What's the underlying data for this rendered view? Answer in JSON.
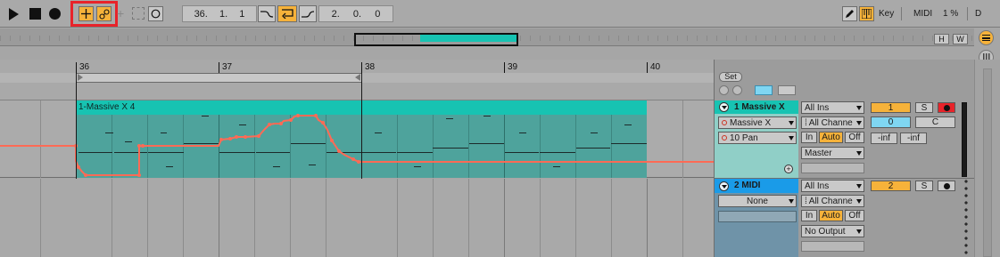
{
  "colors": {
    "accent_orange": "#f6b23a",
    "clip_teal": "#17c3b2",
    "clip_body": "#4ea39c",
    "automation": "#ff6a55",
    "track1_header": "#17c3b2",
    "track2_header": "#1a9be8",
    "highlight_red": "#e8232a"
  },
  "transport": {
    "play_icon": "play-icon",
    "stop_icon": "stop-icon",
    "record_icon": "record-icon",
    "add_icon": "plus-icon",
    "link_icon": "link-icon",
    "position": [
      "36.",
      "1.",
      "1"
    ],
    "loop_length": [
      "2.",
      "0.",
      "0"
    ]
  },
  "right_toolbar": {
    "key_label": "Key",
    "midi_label": "MIDI",
    "cpu_label": "1 %",
    "d_label": "D"
  },
  "overview": {
    "h_label": "H",
    "w_label": "W"
  },
  "ruler": {
    "bars": [
      "36",
      "37",
      "38",
      "39",
      "40"
    ]
  },
  "set_panel": {
    "set_label": "Set"
  },
  "clip": {
    "name": "1-Massive X 4"
  },
  "track1": {
    "name": "1 Massive X",
    "input_type": "All Ins",
    "device": "Massive X",
    "input_channel": "All Channe",
    "param": "10 Pan",
    "monitor_in": "In",
    "monitor_auto": "Auto",
    "monitor_off": "Off",
    "output": "Master",
    "number": "1",
    "solo": "S",
    "send_value": "0",
    "pan": "C",
    "vol_left": "-inf",
    "vol_right": "-inf"
  },
  "track2": {
    "name": "2 MIDI",
    "input_type": "All Ins",
    "device": "None",
    "input_channel": "All Channe",
    "monitor_in": "In",
    "monitor_auto": "Auto",
    "monitor_off": "Off",
    "output": "No Output",
    "number": "2",
    "solo": "S"
  }
}
